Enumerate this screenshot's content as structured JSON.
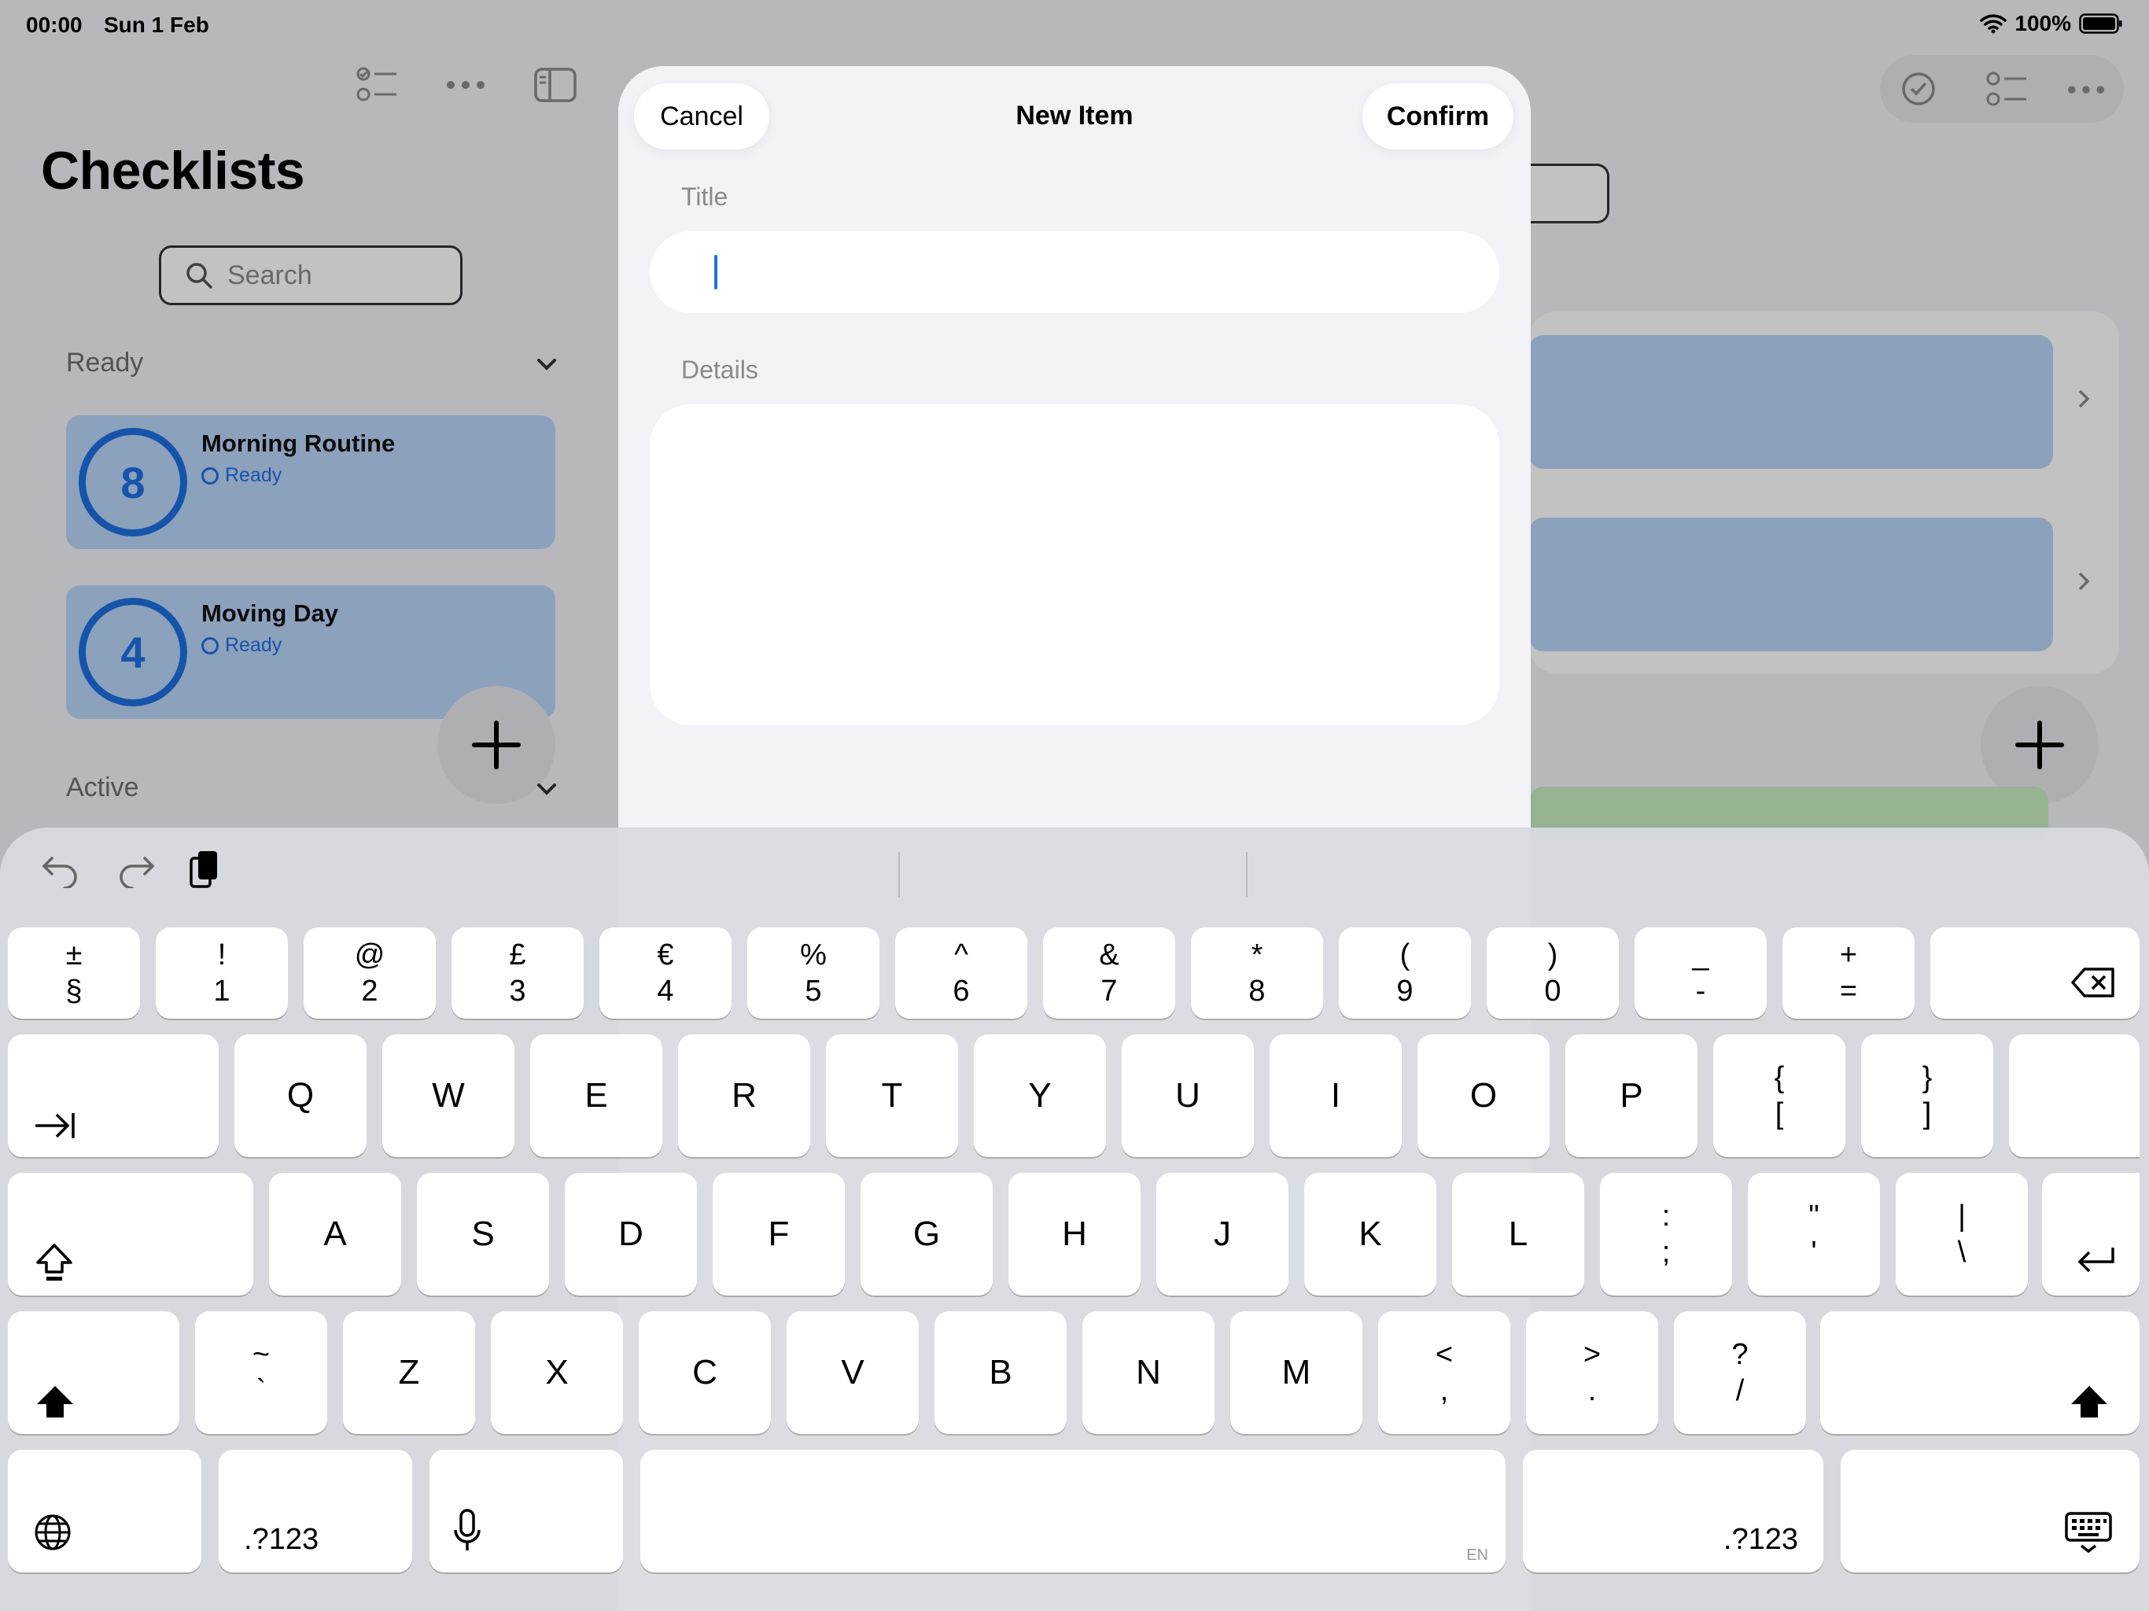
{
  "status_bar": {
    "time": "00:00",
    "date": "Sun 1 Feb",
    "battery": "100%"
  },
  "sidebar": {
    "title": "Checklists",
    "search_placeholder": "Search",
    "sections": [
      {
        "label": "Ready"
      },
      {
        "label": "Active"
      }
    ],
    "items": [
      {
        "count": "8",
        "title": "Morning Routine",
        "status": "Ready"
      },
      {
        "count": "4",
        "title": "Moving Day",
        "status": "Ready"
      }
    ]
  },
  "modal": {
    "title": "New Item",
    "cancel_label": "Cancel",
    "confirm_label": "Confirm",
    "title_label": "Title",
    "title_value": "",
    "details_label": "Details",
    "details_value": ""
  },
  "keyboard": {
    "row1": [
      {
        "top": "±",
        "bottom": "§"
      },
      {
        "top": "!",
        "bottom": "1"
      },
      {
        "top": "@",
        "bottom": "2"
      },
      {
        "top": "£",
        "bottom": "3"
      },
      {
        "top": "€",
        "bottom": "4"
      },
      {
        "top": "%",
        "bottom": "5"
      },
      {
        "top": "^",
        "bottom": "6"
      },
      {
        "top": "&",
        "bottom": "7"
      },
      {
        "top": "*",
        "bottom": "8"
      },
      {
        "top": "(",
        "bottom": "9"
      },
      {
        "top": ")",
        "bottom": "0"
      },
      {
        "top": "_",
        "bottom": "-"
      },
      {
        "top": "+",
        "bottom": "="
      }
    ],
    "row2": [
      "Q",
      "W",
      "E",
      "R",
      "T",
      "Y",
      "U",
      "I",
      "O",
      "P"
    ],
    "row2_extra": [
      {
        "top": "{",
        "bottom": "["
      },
      {
        "top": "}",
        "bottom": "]"
      }
    ],
    "row3": [
      "A",
      "S",
      "D",
      "F",
      "G",
      "H",
      "J",
      "K",
      "L"
    ],
    "row3_extra": [
      {
        "top": ":",
        "bottom": ";"
      },
      {
        "top": "\"",
        "bottom": "'"
      },
      {
        "top": "|",
        "bottom": "\\"
      }
    ],
    "row4_extra_left": {
      "top": "~",
      "bottom": "`"
    },
    "row4": [
      "Z",
      "X",
      "C",
      "V",
      "B",
      "N",
      "M"
    ],
    "row4_extra": [
      {
        "top": "<",
        "bottom": ","
      },
      {
        "top": ">",
        "bottom": "."
      },
      {
        "top": "?",
        "bottom": "/"
      }
    ],
    "numbers_label": ".?123",
    "language": "EN"
  }
}
